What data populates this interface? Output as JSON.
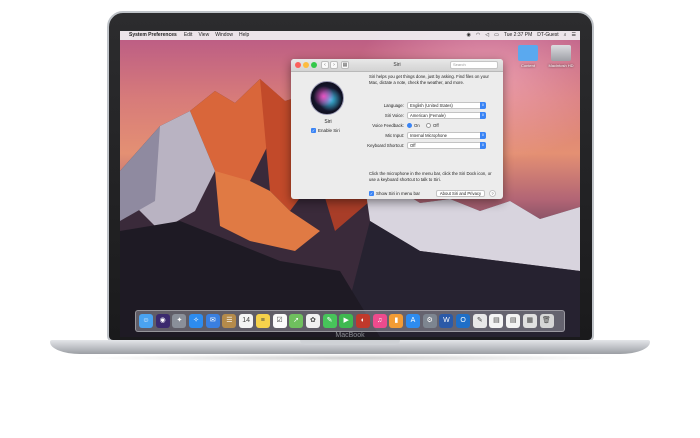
{
  "device": {
    "brand_label": "MacBook"
  },
  "menubar": {
    "apple_glyph": "",
    "app_name": "System Preferences",
    "items": [
      "Edit",
      "View",
      "Window",
      "Help"
    ],
    "clock": "Tue 2:37 PM",
    "user": "DT-Guest",
    "status_icons": [
      "siri-icon",
      "wifi-icon",
      "volume-icon",
      "battery-icon"
    ]
  },
  "desktop": {
    "icons": [
      {
        "label": "Content",
        "icon": "folder-icon",
        "color": "#5aa9ef"
      },
      {
        "label": "Macintosh HD",
        "icon": "hard-drive-icon",
        "color": "#c8c8cc"
      }
    ]
  },
  "window": {
    "title": "Siri",
    "search_placeholder": "Search",
    "back_glyph": "‹",
    "forward_glyph": "›",
    "grid_glyph": "▦",
    "siri_label": "Siri",
    "enable_siri_label": "Enable Siri",
    "enable_siri_checked": true,
    "description": "Siri helps you get things done, just by asking. Find files on your Mac, dictate a note, check the weather, and more.",
    "settings": {
      "language": {
        "label": "Language:",
        "value": "English (United States)"
      },
      "voice": {
        "label": "Siri Voice:",
        "value": "American (Female)"
      },
      "feedback": {
        "label": "Voice Feedback:",
        "on_label": "On",
        "off_label": "Off",
        "selected": "On"
      },
      "mic": {
        "label": "Mic Input:",
        "value": "Internal Microphone"
      },
      "shortcut": {
        "label": "Keyboard Shortcut:",
        "value": "Off"
      }
    },
    "footer_note": "Click the microphone in the menu bar, click the Siri Dock icon, or use a keyboard shortcut to talk to Siri.",
    "show_in_menubar_label": "Show Siri in menu bar",
    "show_in_menubar_checked": true,
    "about_button": "About Siri and Privacy",
    "help_glyph": "?"
  },
  "dock": {
    "apps": [
      {
        "name": "finder-icon",
        "color": "#4aa3f0",
        "glyph": "☺"
      },
      {
        "name": "siri-icon",
        "color": "#3b2a6e",
        "glyph": "◉"
      },
      {
        "name": "launchpad-icon",
        "color": "#8a8f99",
        "glyph": "✦"
      },
      {
        "name": "safari-icon",
        "color": "#2d8cf0",
        "glyph": "✧"
      },
      {
        "name": "mail-icon",
        "color": "#3a7fe0",
        "glyph": "✉"
      },
      {
        "name": "contacts-icon",
        "color": "#b58b4b",
        "glyph": "☰"
      },
      {
        "name": "calendar-icon",
        "color": "#f4f4f4",
        "glyph": "14"
      },
      {
        "name": "notes-icon",
        "color": "#f6d24b",
        "glyph": "≡"
      },
      {
        "name": "reminders-icon",
        "color": "#fafafa",
        "glyph": "☑"
      },
      {
        "name": "maps-icon",
        "color": "#6fbf5e",
        "glyph": "➚"
      },
      {
        "name": "photos-icon",
        "color": "#f0f0f0",
        "glyph": "✿"
      },
      {
        "name": "messages-icon",
        "color": "#47c45a",
        "glyph": "✎"
      },
      {
        "name": "facetime-icon",
        "color": "#3fb950",
        "glyph": "▶"
      },
      {
        "name": "photo-booth-icon",
        "color": "#c0392b",
        "glyph": "◐"
      },
      {
        "name": "itunes-icon",
        "color": "#ec4b8d",
        "glyph": "♫"
      },
      {
        "name": "ibooks-icon",
        "color": "#f39c35",
        "glyph": "▮"
      },
      {
        "name": "app-store-icon",
        "color": "#2d8cf0",
        "glyph": "A"
      },
      {
        "name": "system-preferences-icon",
        "color": "#7d8590",
        "glyph": "⚙"
      },
      {
        "name": "word-icon",
        "color": "#2b5aa8",
        "glyph": "W"
      },
      {
        "name": "outlook-icon",
        "color": "#1f6fc7",
        "glyph": "O"
      },
      {
        "name": "preview-icon",
        "color": "#e8e8e8",
        "glyph": "✎"
      },
      {
        "name": "document-icon",
        "color": "#f4f4f4",
        "glyph": "▤"
      },
      {
        "name": "document-icon",
        "color": "#f4f4f4",
        "glyph": "▤"
      },
      {
        "name": "downloads-icon",
        "color": "#e0e0e0",
        "glyph": "▦"
      },
      {
        "name": "trash-icon",
        "color": "#d6d6d6",
        "glyph": "🗑"
      }
    ]
  }
}
